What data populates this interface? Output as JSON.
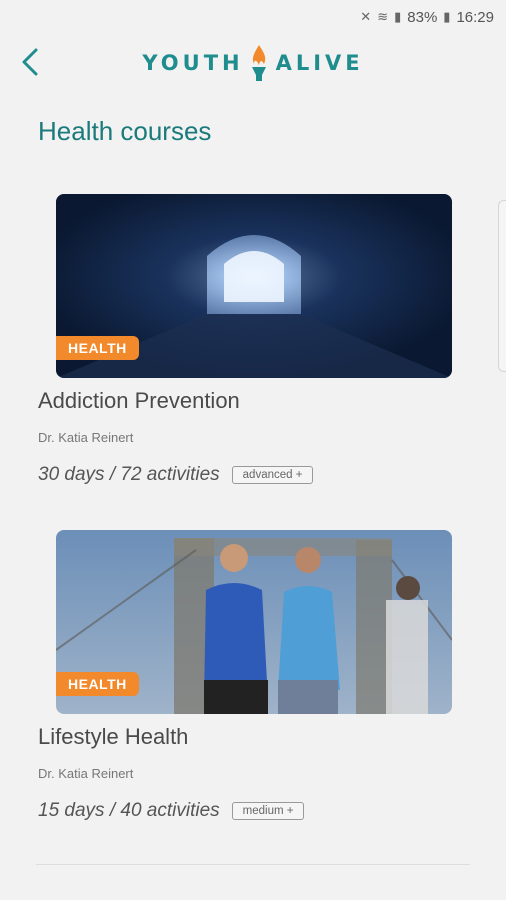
{
  "status": {
    "battery": "83%",
    "time": "16:29"
  },
  "header": {
    "logo_left": "YOUTH",
    "logo_right": "ALIVE"
  },
  "page": {
    "title": "Health courses"
  },
  "courses": [
    {
      "tag": "HEALTH",
      "title": "Addiction Prevention",
      "author": "Dr. Katia Reinert",
      "duration": "30 days / 72 activities",
      "level": "advanced +"
    },
    {
      "tag": "HEALTH",
      "title": "Lifestyle Health",
      "author": "Dr. Katia Reinert",
      "duration": "15 days / 40 activities",
      "level": "medium +"
    }
  ],
  "colors": {
    "accent": "#1f8c8e",
    "tag": "#f28a2c",
    "flame": "#f28a2c"
  }
}
